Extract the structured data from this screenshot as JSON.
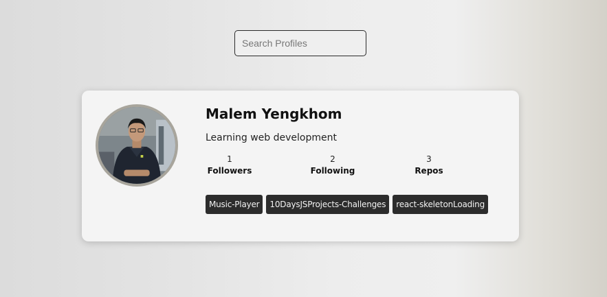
{
  "search": {
    "placeholder": "Search Profiles",
    "value": ""
  },
  "profile": {
    "name": "Malem Yengkhom",
    "bio": "Learning web development",
    "stats": [
      {
        "value": "1",
        "label": "Followers"
      },
      {
        "value": "2",
        "label": "Following"
      },
      {
        "value": "3",
        "label": "Repos"
      }
    ],
    "repos": [
      "Music-Player",
      "10DaysJSProjects-Challenges",
      "react-skeletonLoading"
    ]
  }
}
